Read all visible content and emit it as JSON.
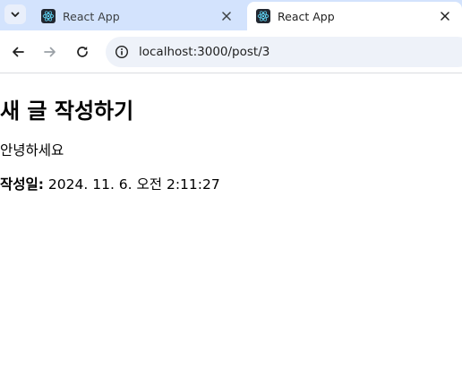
{
  "tabs": [
    {
      "title": "React App",
      "favicon": "react-logo-icon",
      "active": false
    },
    {
      "title": "React App",
      "favicon": "react-logo-icon",
      "active": true
    }
  ],
  "toolbar": {
    "url": "localhost:3000/post/3",
    "icons": [
      "back-arrow-icon",
      "forward-arrow-icon",
      "reload-icon",
      "site-info-icon"
    ]
  },
  "page": {
    "heading": "새 글 작성하기",
    "content": "안녕하세요",
    "meta_label": "작성일:",
    "meta_value": "2024. 11. 6. 오전 2:11:27"
  },
  "colors": {
    "tabstrip_bg": "#d3e3fd",
    "omnibox_bg": "#eef2f9",
    "react_cyan": "#61dafb"
  }
}
